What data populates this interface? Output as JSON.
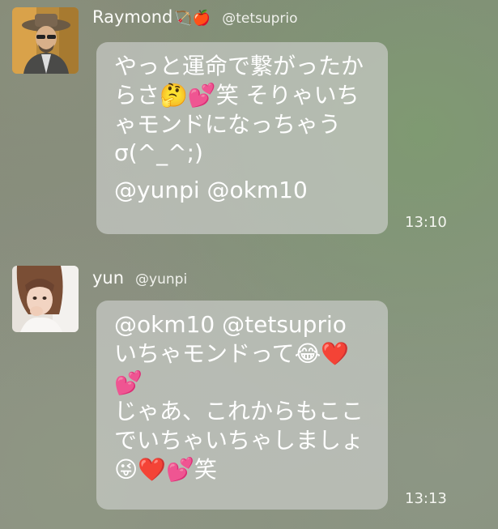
{
  "messages": [
    {
      "user": {
        "display_name": "Raymond",
        "name_emoji": "🏹🍎",
        "handle": "@tetsuprio",
        "avatar_icon": "man-with-hat-avatar"
      },
      "text": "やっと運命で繋がったからさ🤔💕笑 そりゃいちゃモンドになっちゃうσ(^_^;)",
      "mentions": "@yunpi @okm10",
      "time": "13:10"
    },
    {
      "user": {
        "display_name": "yun",
        "handle": "@yunpi",
        "avatar_icon": "girl-avatar"
      },
      "mentions": "@okm10 @tetsuprio",
      "text": "いちゃモンドって😂❤️💕\nじゃあ、これからもここでいちゃいちゃしましょ😜❤️💕笑",
      "time": "13:13"
    }
  ],
  "colors": {
    "bubble": "#c8cbc6",
    "text": "#ffffff"
  }
}
